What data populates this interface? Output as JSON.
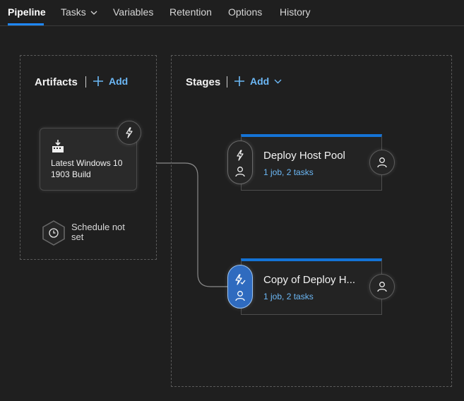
{
  "tabs": [
    {
      "label": "Pipeline",
      "active": true
    },
    {
      "label": "Tasks",
      "has_dropdown": true
    },
    {
      "label": "Variables"
    },
    {
      "label": "Retention"
    },
    {
      "label": "Options"
    },
    {
      "label": "History"
    }
  ],
  "artifacts": {
    "title": "Artifacts",
    "add_label": "Add",
    "items": [
      {
        "name": "Latest Windows 10 1903 Build",
        "icon": "build-icon",
        "trigger_icon": "lightning-icon"
      }
    ],
    "schedule": {
      "text": "Schedule not set",
      "icon": "clock-icon"
    }
  },
  "stages": {
    "title": "Stages",
    "add_label": "Add",
    "items": [
      {
        "name": "Deploy Host Pool",
        "summary": "1 job, 2 tasks",
        "selected_trigger": false
      },
      {
        "name": "Copy of Deploy H...",
        "summary": "1 job, 2 tasks",
        "selected_trigger": true
      }
    ]
  },
  "colors": {
    "accent": "#1e88ff",
    "link": "#6cb8f6",
    "stage_bar": "#1473d6",
    "selected_trigger": "#2f6bbf",
    "background": "#1f1f1f"
  }
}
